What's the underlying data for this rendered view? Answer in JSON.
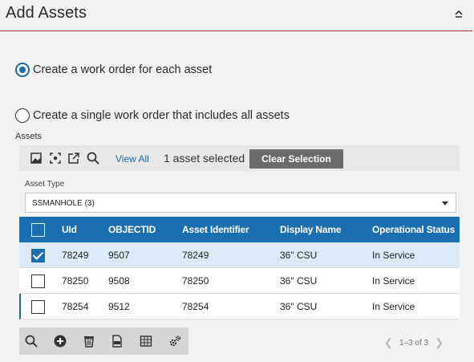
{
  "panel": {
    "title": "Add Assets"
  },
  "options": {
    "each": "Create a work order for each asset",
    "single": "Create a single work order that includes all assets"
  },
  "assets": {
    "label": "Assets",
    "view_all": "View All",
    "selected_text": "1 asset selected",
    "clear_selection": "Clear Selection"
  },
  "asset_type": {
    "label": "Asset Type",
    "value": "SSMANHOLE (3)"
  },
  "grid": {
    "columns": [
      "UId",
      "OBJECTID",
      "Asset Identifier",
      "Display Name",
      "Operational Status"
    ],
    "rows": [
      {
        "uid": "78249",
        "objectid": "9507",
        "identifier": "78249",
        "display": "36\" CSU",
        "status": "In Service",
        "checked": true
      },
      {
        "uid": "78250",
        "objectid": "9508",
        "identifier": "78250",
        "display": "36\" CSU",
        "status": "In Service",
        "checked": false
      },
      {
        "uid": "78254",
        "objectid": "9512",
        "identifier": "78254",
        "display": "36\" CSU",
        "status": "In Service",
        "checked": false
      }
    ]
  },
  "pager": {
    "text": "1–3 of 3"
  },
  "colors": {
    "accent": "#1a6fb0",
    "header_rule": "#a8313a",
    "selected_row": "#dbeaf6"
  }
}
